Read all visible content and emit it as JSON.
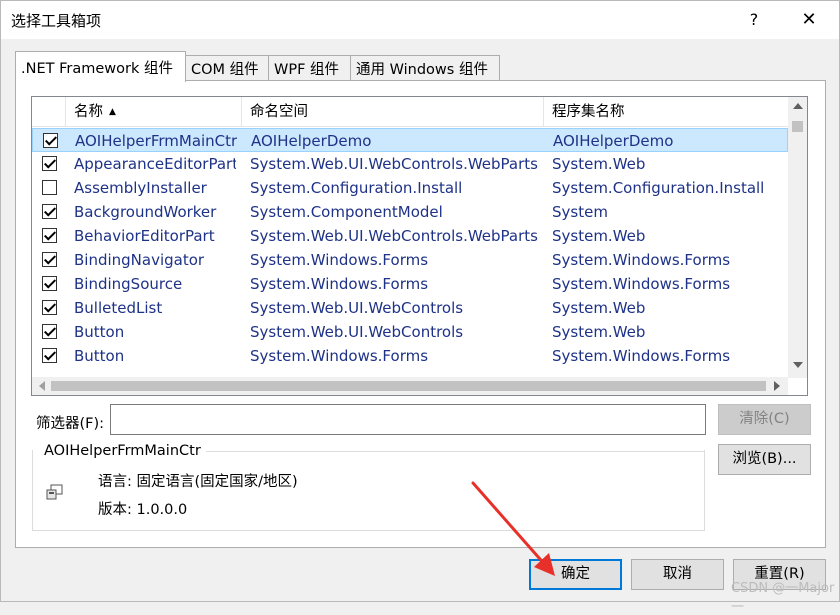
{
  "window": {
    "title": "选择工具箱项",
    "help_label": "?",
    "close_label": "✕"
  },
  "tabs": [
    {
      "label": ".NET Framework 组件",
      "active": true
    },
    {
      "label": "COM 组件",
      "active": false
    },
    {
      "label": "WPF 组件",
      "active": false
    },
    {
      "label": "通用 Windows 组件",
      "active": false
    }
  ],
  "list": {
    "columns": {
      "name": "名称",
      "namespace": "命名空间",
      "assembly": "程序集名称"
    },
    "sort_indicator": "▲",
    "rows": [
      {
        "checked": true,
        "selected": true,
        "name": "AOIHelperFrmMainCtr",
        "namespace": "AOIHelperDemo",
        "assembly": "AOIHelperDemo"
      },
      {
        "checked": true,
        "selected": false,
        "name": "AppearanceEditorPart",
        "namespace": "System.Web.UI.WebControls.WebParts",
        "assembly": "System.Web"
      },
      {
        "checked": false,
        "selected": false,
        "name": "AssemblyInstaller",
        "namespace": "System.Configuration.Install",
        "assembly": "System.Configuration.Install"
      },
      {
        "checked": true,
        "selected": false,
        "name": "BackgroundWorker",
        "namespace": "System.ComponentModel",
        "assembly": "System"
      },
      {
        "checked": true,
        "selected": false,
        "name": "BehaviorEditorPart",
        "namespace": "System.Web.UI.WebControls.WebParts",
        "assembly": "System.Web"
      },
      {
        "checked": true,
        "selected": false,
        "name": "BindingNavigator",
        "namespace": "System.Windows.Forms",
        "assembly": "System.Windows.Forms"
      },
      {
        "checked": true,
        "selected": false,
        "name": "BindingSource",
        "namespace": "System.Windows.Forms",
        "assembly": "System.Windows.Forms"
      },
      {
        "checked": true,
        "selected": false,
        "name": "BulletedList",
        "namespace": "System.Web.UI.WebControls",
        "assembly": "System.Web"
      },
      {
        "checked": true,
        "selected": false,
        "name": "Button",
        "namespace": "System.Web.UI.WebControls",
        "assembly": "System.Web"
      },
      {
        "checked": true,
        "selected": false,
        "name": "Button",
        "namespace": "System.Windows.Forms",
        "assembly": "System.Windows.Forms"
      }
    ]
  },
  "filter": {
    "label": "筛选器(F):",
    "value": "",
    "clear_label": "清除(C)"
  },
  "details": {
    "title": "AOIHelperFrmMainCtr",
    "language": "语言:  固定语言(固定国家/地区)",
    "version": "版本:  1.0.0.0",
    "browse_label": "浏览(B)..."
  },
  "buttons": {
    "ok": "确定",
    "cancel": "取消",
    "reset": "重置(R)"
  },
  "watermark": "CSDN @一Major一",
  "colors": {
    "selection": "#cce8ff",
    "link_text": "#1e3287",
    "arrow": "#e8302a",
    "default_button_border": "#0078d7"
  }
}
